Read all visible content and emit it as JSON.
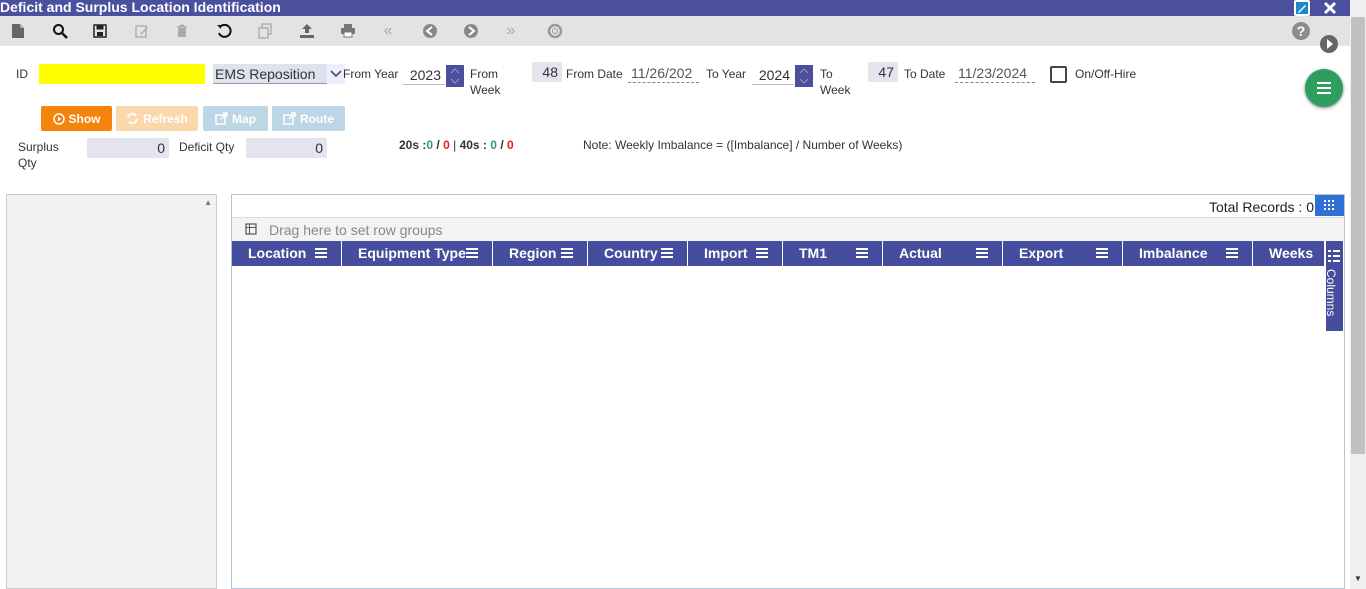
{
  "window": {
    "title": "Deficit and Surplus Location Identification"
  },
  "form": {
    "id_label": "ID",
    "id_value": "",
    "mode_value": "EMS Reposition",
    "from_year_label": "From Year",
    "from_year": "2023",
    "from_week_label_1": "From",
    "from_week_label_2": "Week",
    "from_week": "48",
    "from_date_label": "From Date",
    "from_date": "11/26/202",
    "to_year_label": "To Year",
    "to_year": "2024",
    "to_week_label_1": "To",
    "to_week_label_2": "Week",
    "to_week": "47",
    "to_date_label": "To Date",
    "to_date": "11/23/2024",
    "onoff_label": "On/Off-Hire"
  },
  "buttons": {
    "show": "Show",
    "refresh": "Refresh",
    "map": "Map",
    "route": "Route"
  },
  "summary": {
    "surplus_label_1": "Surplus",
    "surplus_label_2": "Qty",
    "surplus_value": "0",
    "deficit_label": "Deficit Qty",
    "deficit_value": "0",
    "s20_label": "20s :",
    "s20_a": "0",
    "s20_sep": "/",
    "s20_b": "0",
    "pipe": "|",
    "s40_label": "40s :",
    "s40_a": "0",
    "s40_sep": "/",
    "s40_b": "0",
    "note": "Note: Weekly Imbalance = ([Imbalance] / Number of Weeks)"
  },
  "grid": {
    "total_label": "Total Records :",
    "total_value": "0",
    "group_hint": "Drag here to set row groups",
    "columns_panel": "Columns",
    "columns": [
      "Location",
      "Equipment Type",
      "Region",
      "Country",
      "Import",
      "TM1",
      "Actual",
      "Export",
      "Imbalance",
      "Weeks"
    ]
  },
  "colors": {
    "accent": "#4a4f9e",
    "show": "#f5840c",
    "refresh": "#fbd7ac",
    "map": "#bcd6e6",
    "id_bg": "#ffff00",
    "green": "#2e9e5e",
    "red": "#e02020"
  }
}
